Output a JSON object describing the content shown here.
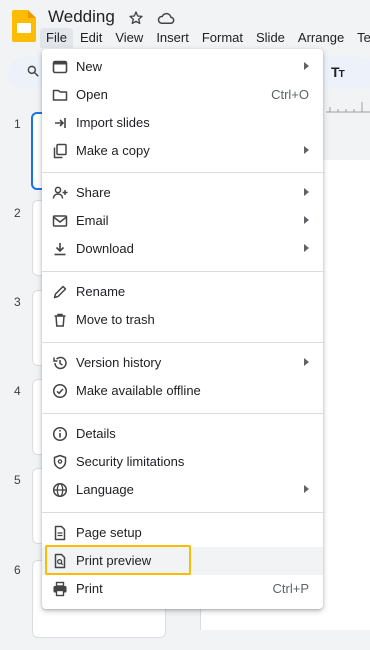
{
  "app": {
    "doc_title": "Wedding"
  },
  "menubar": [
    "File",
    "Edit",
    "View",
    "Insert",
    "Format",
    "Slide",
    "Arrange",
    "Te"
  ],
  "slides": [
    "1",
    "2",
    "3",
    "4",
    "5",
    "6"
  ],
  "file_menu": {
    "items": [
      {
        "label": "New",
        "submenu": true,
        "icon": "new-slides-icon"
      },
      {
        "label": "Open",
        "shortcut": "Ctrl+O",
        "icon": "folder-icon"
      },
      {
        "label": "Import slides",
        "icon": "import-icon"
      },
      {
        "label": "Make a copy",
        "submenu": true,
        "icon": "copy-icon"
      },
      {
        "label": "Share",
        "submenu": true,
        "icon": "share-person-icon"
      },
      {
        "label": "Email",
        "submenu": true,
        "icon": "email-icon"
      },
      {
        "label": "Download",
        "submenu": true,
        "icon": "download-icon"
      },
      {
        "label": "Rename",
        "icon": "pencil-icon"
      },
      {
        "label": "Move to trash",
        "icon": "trash-icon"
      },
      {
        "label": "Version history",
        "submenu": true,
        "icon": "history-icon"
      },
      {
        "label": "Make available offline",
        "icon": "offline-icon"
      },
      {
        "label": "Details",
        "icon": "info-icon"
      },
      {
        "label": "Security limitations",
        "icon": "shield-icon"
      },
      {
        "label": "Language",
        "submenu": true,
        "icon": "globe-icon"
      },
      {
        "label": "Page setup",
        "icon": "page-icon"
      },
      {
        "label": "Print preview",
        "icon": "print-preview-icon"
      },
      {
        "label": "Print",
        "shortcut": "Ctrl+P",
        "icon": "printer-icon"
      }
    ]
  },
  "colors": {
    "accent": "#1a73e8",
    "highlight": "#fbbc04",
    "logo": "#fbbc04"
  }
}
